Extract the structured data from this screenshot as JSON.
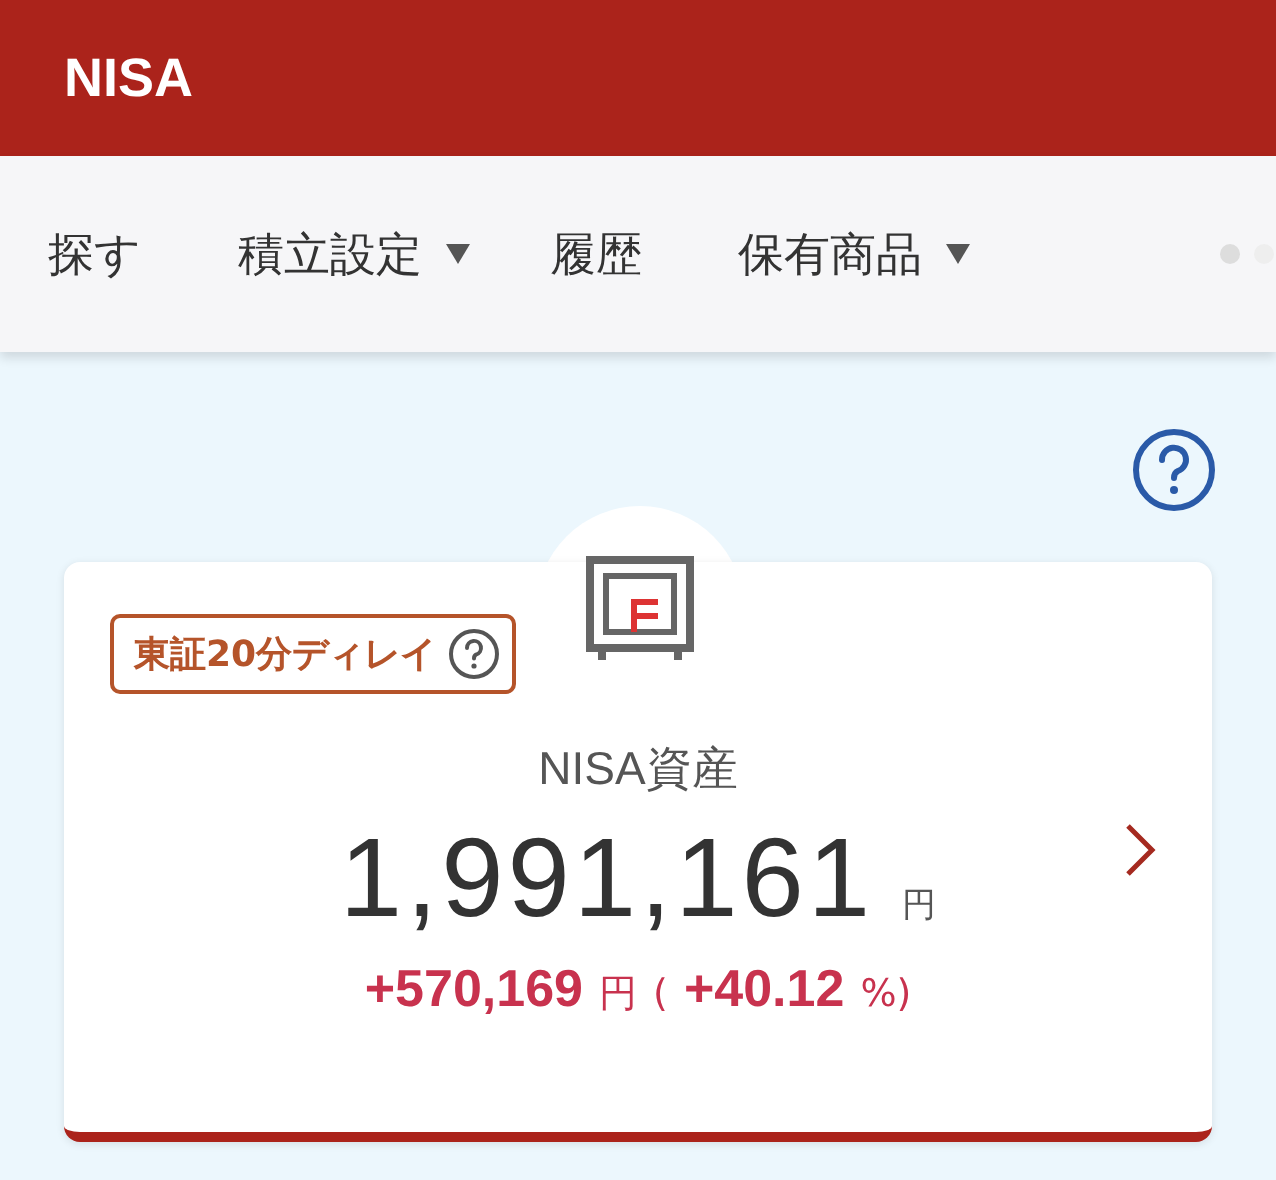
{
  "header": {
    "title": "NISA"
  },
  "nav_tabs": [
    {
      "label": "探す",
      "dropdown": false
    },
    {
      "label": "積立設定",
      "dropdown": true
    },
    {
      "label": "履歴",
      "dropdown": false
    },
    {
      "label": "保有商品",
      "dropdown": true
    }
  ],
  "asset_card": {
    "delay_badge": "東証20分ディレイ",
    "label": "NISA資産",
    "amount": "1,991,161",
    "unit": "円",
    "change": {
      "amount": "+570,169",
      "unit": "円",
      "open": "(",
      "percent": "+40.12",
      "close": "%)"
    }
  }
}
